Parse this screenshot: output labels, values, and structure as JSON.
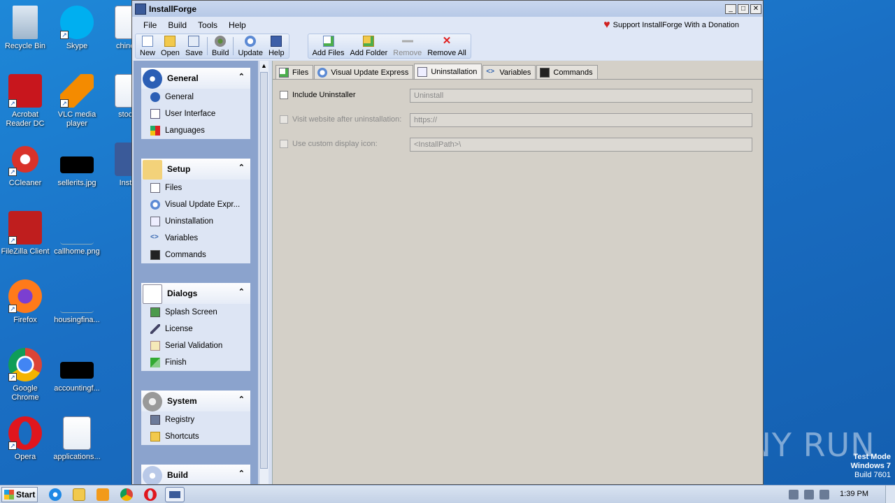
{
  "desktop": {
    "icons": [
      {
        "label": "Recycle Bin"
      },
      {
        "label": "Skype"
      },
      {
        "label": "chinese"
      },
      {
        "label": "Acrobat Reader DC"
      },
      {
        "label": "VLC media player"
      },
      {
        "label": "stockg"
      },
      {
        "label": "CCleaner"
      },
      {
        "label": "sellerits.jpg"
      },
      {
        "label": "Install"
      },
      {
        "label": "FileZilla Client"
      },
      {
        "label": "callhome.png"
      },
      {
        "label": "Firefox"
      },
      {
        "label": "housingfina..."
      },
      {
        "label": "Google Chrome"
      },
      {
        "label": "accountingf..."
      },
      {
        "label": "Opera"
      },
      {
        "label": "applications..."
      }
    ],
    "watermark": "ANY RUN",
    "test_mode": {
      "line1": "Test Mode",
      "line2": "Windows 7",
      "line3": "Build 7601"
    }
  },
  "window": {
    "title": "InstallForge",
    "controls": {
      "minimize": "_",
      "maximize": "□",
      "close": "✕"
    }
  },
  "menu": {
    "items": [
      "File",
      "Build",
      "Tools",
      "Help"
    ],
    "donate": "Support InstallForge With a Donation"
  },
  "toolbar": {
    "group1": [
      "New",
      "Open",
      "Save",
      "Build",
      "Update",
      "Help"
    ],
    "group2": [
      "Add Files",
      "Add Folder",
      "Remove",
      "Remove All"
    ]
  },
  "nav": {
    "groups": [
      {
        "title": "General",
        "items": [
          "General",
          "User Interface",
          "Languages"
        ]
      },
      {
        "title": "Setup",
        "items": [
          "Files",
          "Visual Update Expr...",
          "Uninstallation",
          "Variables",
          "Commands"
        ]
      },
      {
        "title": "Dialogs",
        "items": [
          "Splash Screen",
          "License",
          "Serial Validation",
          "Finish"
        ]
      },
      {
        "title": "System",
        "items": [
          "Registry",
          "Shortcuts"
        ]
      },
      {
        "title": "Build",
        "items": []
      }
    ],
    "chevron": "⌃"
  },
  "tabs": [
    "Files",
    "Visual Update Express",
    "Uninstallation",
    "Variables",
    "Commands"
  ],
  "form": {
    "include_uninstaller": {
      "label": "Include Uninstaller",
      "value": "Uninstall"
    },
    "visit_website": {
      "label": "Visit website after uninstallation:",
      "value": "https://"
    },
    "custom_icon": {
      "label": "Use custom display icon:",
      "value": "<InstallPath>\\"
    }
  },
  "taskbar": {
    "start": "Start",
    "clock": "1:39 PM"
  },
  "colors": {
    "desktop": "#1a73c9",
    "nav_bg": "#8ba3cd",
    "content_bg": "#d4d0c8"
  }
}
